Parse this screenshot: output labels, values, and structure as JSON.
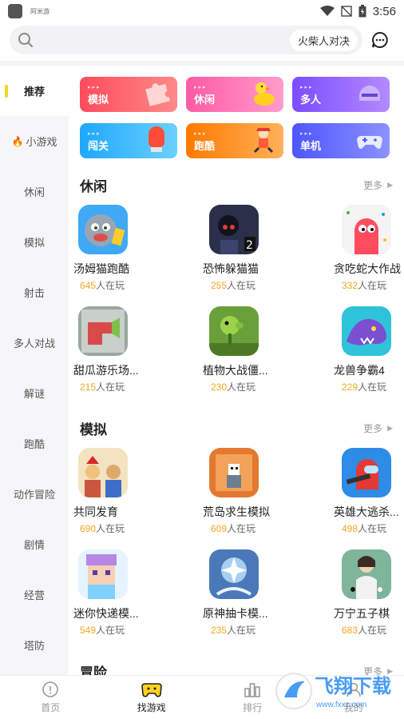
{
  "status_bar": {
    "app_name": "阿米游",
    "time": "3:56"
  },
  "search": {
    "hint": "火柴人对决"
  },
  "sidebar": {
    "items": [
      {
        "label": "推荐"
      },
      {
        "label": "小游戏"
      },
      {
        "label": "休闲"
      },
      {
        "label": "模拟"
      },
      {
        "label": "射击"
      },
      {
        "label": "多人对战"
      },
      {
        "label": "解谜"
      },
      {
        "label": "跑酷"
      },
      {
        "label": "动作冒险"
      },
      {
        "label": "剧情"
      },
      {
        "label": "经营"
      },
      {
        "label": "塔防"
      }
    ]
  },
  "categories": [
    {
      "label": "模拟",
      "color": "#ff5d6c",
      "icon": "puzzle-icon"
    },
    {
      "label": "休闲",
      "color": "#ff6bb0",
      "icon": "duck-icon"
    },
    {
      "label": "多人",
      "color": "#8a5cff",
      "icon": "helmet-icon"
    },
    {
      "label": "闯关",
      "color": "#2fb4ff",
      "icon": "boxing-glove-icon"
    },
    {
      "label": "跑酷",
      "color": "#ff8a1e",
      "icon": "runner-icon"
    },
    {
      "label": "单机",
      "color": "#5b63ff",
      "icon": "gamepad-icon"
    }
  ],
  "sections": [
    {
      "title": "休闲",
      "more": "更多",
      "games": [
        {
          "name": "汤姆猫跑酷",
          "count": "645",
          "suffix": "人在玩",
          "color": "#3fa9f5"
        },
        {
          "name": "恐怖躲猫猫",
          "count": "255",
          "suffix": "人在玩",
          "color": "#2b2f4a"
        },
        {
          "name": "贪吃蛇大作战",
          "count": "332",
          "suffix": "人在玩",
          "color": "#f4f4f4"
        },
        {
          "name": "甜瓜游乐场...",
          "count": "215",
          "suffix": "人在玩",
          "color": "#9aa7a0"
        },
        {
          "name": "植物大战僵...",
          "count": "230",
          "suffix": "人在玩",
          "color": "#6aa03a"
        },
        {
          "name": "龙兽争霸4",
          "count": "229",
          "suffix": "人在玩",
          "color": "#7a4fd1"
        }
      ]
    },
    {
      "title": "模拟",
      "more": "更多",
      "games": [
        {
          "name": "共同发育",
          "count": "690",
          "suffix": "人在玩",
          "color": "#c9563d"
        },
        {
          "name": "荒岛求生模拟",
          "count": "609",
          "suffix": "人在玩",
          "color": "#e3792e"
        },
        {
          "name": "英雄大逃杀...",
          "count": "498",
          "suffix": "人在玩",
          "color": "#2e8be6"
        },
        {
          "name": "迷你快递模...",
          "count": "549",
          "suffix": "人在玩",
          "color": "#b787e6"
        },
        {
          "name": "原神抽卡模...",
          "count": "235",
          "suffix": "人在玩",
          "color": "#7fb6e8"
        },
        {
          "name": "万宁五子棋",
          "count": "683",
          "suffix": "人在玩",
          "color": "#7fb59a"
        }
      ]
    },
    {
      "title": "冒险",
      "more": "更多"
    }
  ],
  "bottom_nav": [
    {
      "label": "首页",
      "icon": "home-icon"
    },
    {
      "label": "找游戏",
      "icon": "gamepad-nav-icon"
    },
    {
      "label": "排行",
      "icon": "rank-icon"
    },
    {
      "label": "我的",
      "icon": "user-icon"
    }
  ],
  "watermark": {
    "title": "飞翔下载",
    "url": "www.fxxz.com"
  }
}
